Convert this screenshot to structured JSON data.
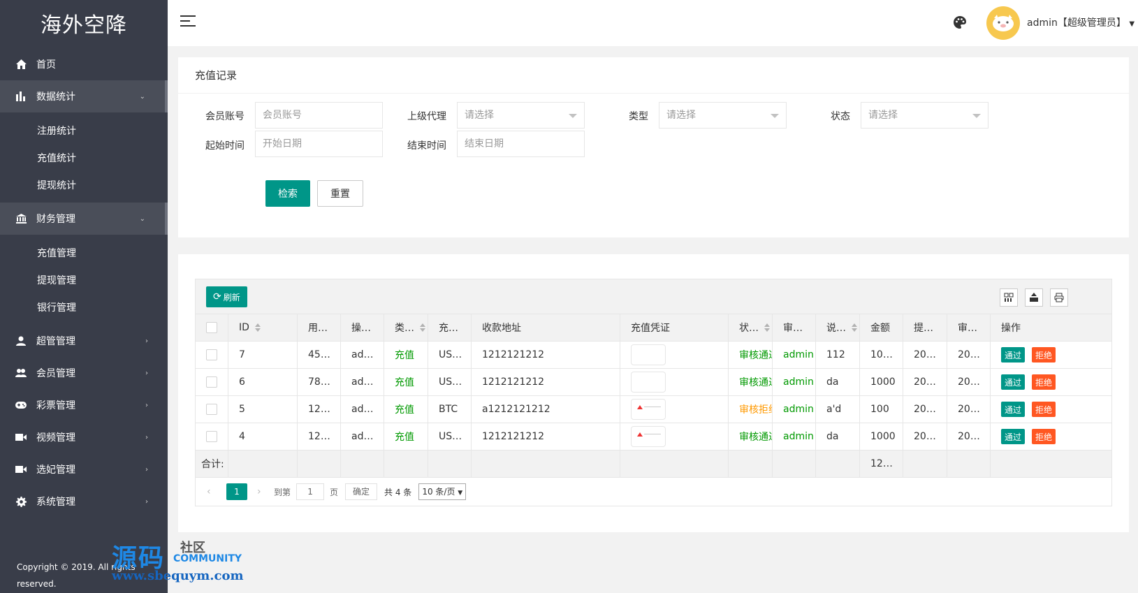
{
  "app": {
    "logo": "海外空降",
    "copyright": "Copyright © 2019. All rights reserved."
  },
  "sidebar": {
    "home": "首页",
    "data_stats": {
      "label": "数据统计",
      "items": [
        "注册统计",
        "充值统计",
        "提现统计"
      ]
    },
    "finance": {
      "label": "财务管理",
      "items": [
        "充值管理",
        "提现管理",
        "银行管理"
      ]
    },
    "others": [
      "超管管理",
      "会员管理",
      "彩票管理",
      "视频管理",
      "选妃管理",
      "系统管理"
    ]
  },
  "header": {
    "user": "admin【超级管理员】"
  },
  "search": {
    "title": "充值记录",
    "member_label": "会员账号",
    "member_placeholder": "会员账号",
    "agent_label": "上级代理",
    "agent_value": "请选择",
    "type_label": "类型",
    "type_value": "请选择",
    "status_label": "状态",
    "status_value": "请选择",
    "start_label": "起始时间",
    "start_placeholder": "开始日期",
    "end_label": "结束时间",
    "end_placeholder": "结束日期",
    "search_btn": "检索",
    "reset_btn": "重置"
  },
  "table": {
    "refresh": "刷新",
    "headers": [
      "ID",
      "用…",
      "操…",
      "类…",
      "充…",
      "收款地址",
      "充值凭证",
      "状…",
      "审…",
      "说…",
      "金额",
      "提…",
      "审…",
      "操作"
    ],
    "rows": [
      {
        "id": "7",
        "user": "45…",
        "op": "ad…",
        "type": "充值",
        "coin": "US…",
        "addr": "1212121212",
        "img": false,
        "status": "审核通过",
        "status_color": "green",
        "auditor": "admin",
        "note": "112",
        "amount": "10…",
        "t1": "20…",
        "t2": "20…"
      },
      {
        "id": "6",
        "user": "78…",
        "op": "ad…",
        "type": "充值",
        "coin": "US…",
        "addr": "1212121212",
        "img": false,
        "status": "审核通过",
        "status_color": "green",
        "auditor": "admin",
        "note": "da",
        "amount": "1000",
        "t1": "20…",
        "t2": "20…"
      },
      {
        "id": "5",
        "user": "12…",
        "op": "ad…",
        "type": "充值",
        "coin": "BTC",
        "addr": "a1212121212",
        "img": true,
        "status": "审核拒绝",
        "status_color": "orange",
        "auditor": "admin",
        "note": "a'd",
        "amount": "100",
        "t1": "20…",
        "t2": "20…"
      },
      {
        "id": "4",
        "user": "12…",
        "op": "ad…",
        "type": "充值",
        "coin": "US…",
        "addr": "1212121212",
        "img": true,
        "status": "审核通过",
        "status_color": "green",
        "auditor": "admin",
        "note": "da",
        "amount": "1000",
        "t1": "20…",
        "t2": "20…"
      }
    ],
    "pass": "通过",
    "reject": "拒绝",
    "total_label": "合计:",
    "total_amount": "12…"
  },
  "pager": {
    "current": "1",
    "goto": "到第",
    "page_input": "1",
    "page_unit": "页",
    "confirm": "确定",
    "total": "共 4 条",
    "per_page": "10 条/页"
  },
  "watermark": {
    "big": "源码",
    "small": "社区",
    "community": "COMMUNITY",
    "url": "www.sbequym.com"
  },
  "colors": {
    "sidebar": "#393d49",
    "primary": "#009688",
    "danger": "#ff5722",
    "success": "#009900",
    "warning": "#ff9900"
  }
}
